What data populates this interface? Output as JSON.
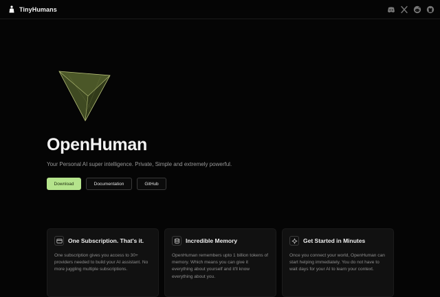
{
  "header": {
    "brand_name": "TinyHumans",
    "social_icons": [
      "discord-icon",
      "x-icon",
      "reddit-icon",
      "github-icon"
    ]
  },
  "hero": {
    "logo_icon": "triangle-prism-logo",
    "title": "OpenHuman",
    "tagline": "Your Personal AI super intelligence. Private, Simple and extremely powerful.",
    "buttons": {
      "download": "Download",
      "documentation": "Documentation",
      "github": "GitHub"
    }
  },
  "features": [
    {
      "icon": "card-icon",
      "title": "One Subscription. That's it.",
      "text": "One subscription gives you access to 30+ providers needed to build your AI assistant. No more juggling multiple subscriptions."
    },
    {
      "icon": "database-icon",
      "title": "Incredible Memory",
      "text": "OpenHuman remembers upto 1 billion tokens of memory. Which means you can give it everything about yourself and it'll know everything about you."
    },
    {
      "icon": "sparkle-icon",
      "title": "Get Started in Minutes",
      "text": "Once you connect your world, OpenHuman can start helping immediately. You do not have to wait days for your AI to learn your context."
    }
  ],
  "colors": {
    "background": "#050505",
    "accent": "#b5e48c",
    "card": "#111111",
    "logo_fill": "#3f4a22"
  }
}
